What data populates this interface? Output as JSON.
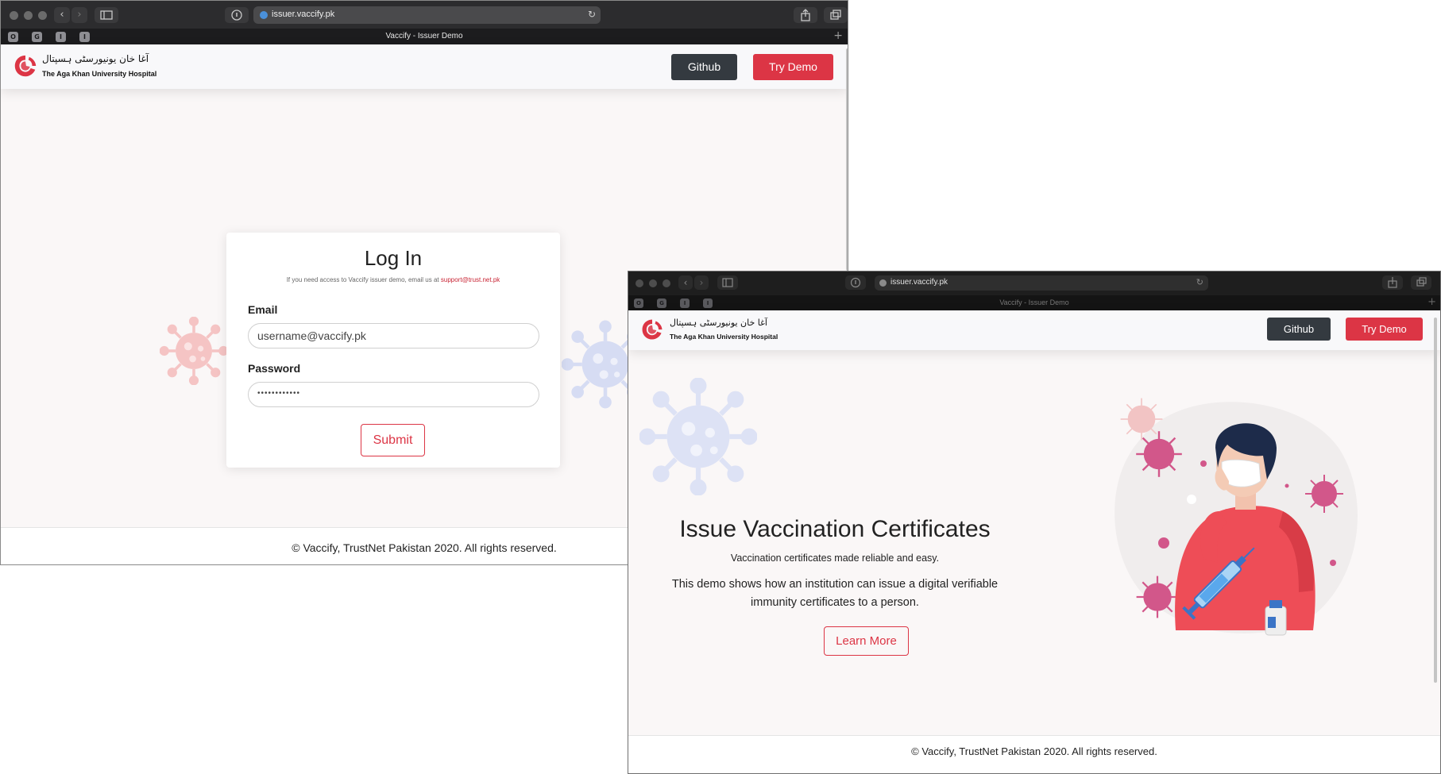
{
  "window1": {
    "url": "issuer.vaccify.pk",
    "tab_title": "Vaccify - Issuer Demo",
    "favicons": [
      "O",
      "G",
      "I",
      "I"
    ],
    "logo": {
      "urdu": "آغا خان یونیورسٹی ہسپتال",
      "english": "The Aga Khan University Hospital"
    },
    "nav": {
      "github": "Github",
      "try_demo": "Try Demo"
    },
    "login": {
      "title": "Log In",
      "hint_prefix": "If you need access to Vaccify issuer demo, email us at",
      "hint_email": "support@trust.net.pk",
      "email_label": "Email",
      "email_value": "username@vaccify.pk",
      "password_label": "Password",
      "password_value": "••••••••••••",
      "submit": "Submit"
    },
    "footer": "© Vaccify, TrustNet Pakistan 2020. All rights reserved."
  },
  "window2": {
    "url": "issuer.vaccify.pk",
    "tab_title": "Vaccify - Issuer Demo",
    "favicons": [
      "O",
      "G",
      "I",
      "I"
    ],
    "logo": {
      "urdu": "آغا خان یونیورسٹی ہسپتال",
      "english": "The Aga Khan University Hospital"
    },
    "nav": {
      "github": "Github",
      "try_demo": "Try Demo"
    },
    "hero": {
      "title": "Issue Vaccination Certificates",
      "subtitle": "Vaccination certificates made reliable and easy.",
      "description": "This demo shows how an institution can issue a digital verifiable immunity certificates to a person.",
      "cta": "Learn More"
    },
    "footer": "© Vaccify, TrustNet Pakistan 2020. All rights reserved."
  },
  "colors": {
    "brand_red": "#dc3545",
    "dark_button": "#343a40",
    "virus_pink": "#d65b8c",
    "virus_blue": "#aeb8e6"
  }
}
